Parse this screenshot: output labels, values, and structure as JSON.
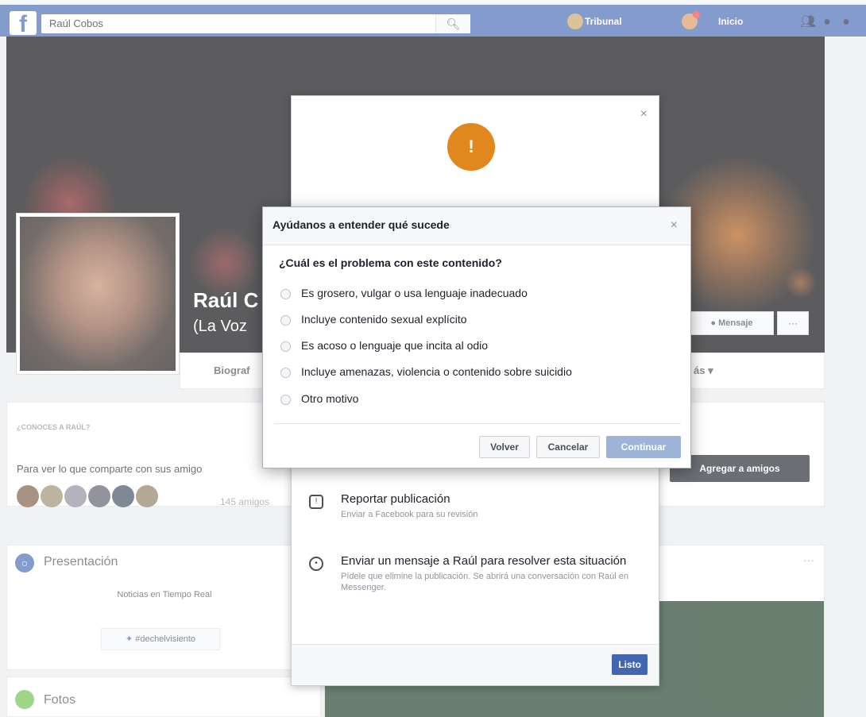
{
  "topbar": {
    "search_value": "Raúl Cobos",
    "user_name": "Tribunal",
    "home_label": "Inicio"
  },
  "profile": {
    "name": "Raúl C",
    "subtitle": "(La Voz",
    "message_button": "Mensaje",
    "more_button": "···",
    "nav_biography": "Biograf",
    "nav_more": "ás ▾"
  },
  "know": {
    "title": "¿CONOCES A RAÚL?",
    "text": "Para ver lo que comparte con sus amigo",
    "friend_count": "145 amigos",
    "add_friend_button": "Agregar a amigos"
  },
  "intro": {
    "title": "Presentación",
    "description": "Noticias en Tiempo Real",
    "link": "#dechelvisiento"
  },
  "photos": {
    "title": "Fotos"
  },
  "feed": {
    "menu": "···"
  },
  "back_dialog": {
    "close": "×",
    "emblem": "!",
    "options": [
      {
        "title": "Reportar publicación",
        "desc": "Enviar a Facebook para su revisión"
      },
      {
        "title": "Enviar un mensaje a Raúl para resolver esta situación",
        "desc": "Pídele que elimine la publicación. Se abrirá una conversación con Raúl en Messenger."
      }
    ],
    "done_button": "Listo"
  },
  "front_dialog": {
    "title": "Ayúdanos a entender qué sucede",
    "close": "×",
    "question": "¿Cuál es el problema con este contenido?",
    "options": [
      "Es grosero, vulgar o usa lenguaje inadecuado",
      "Incluye contenido sexual explícito",
      "Es acoso o lenguaje que incita al odio",
      "Incluye amenazas, violencia o contenido sobre suicidio",
      "Otro motivo"
    ],
    "back_button": "Volver",
    "cancel_button": "Cancelar",
    "continue_button": "Continuar"
  },
  "colors": {
    "brand": "#4267b2",
    "emblem": "#e0871e",
    "continue_disabled": "#9cb4d8"
  }
}
